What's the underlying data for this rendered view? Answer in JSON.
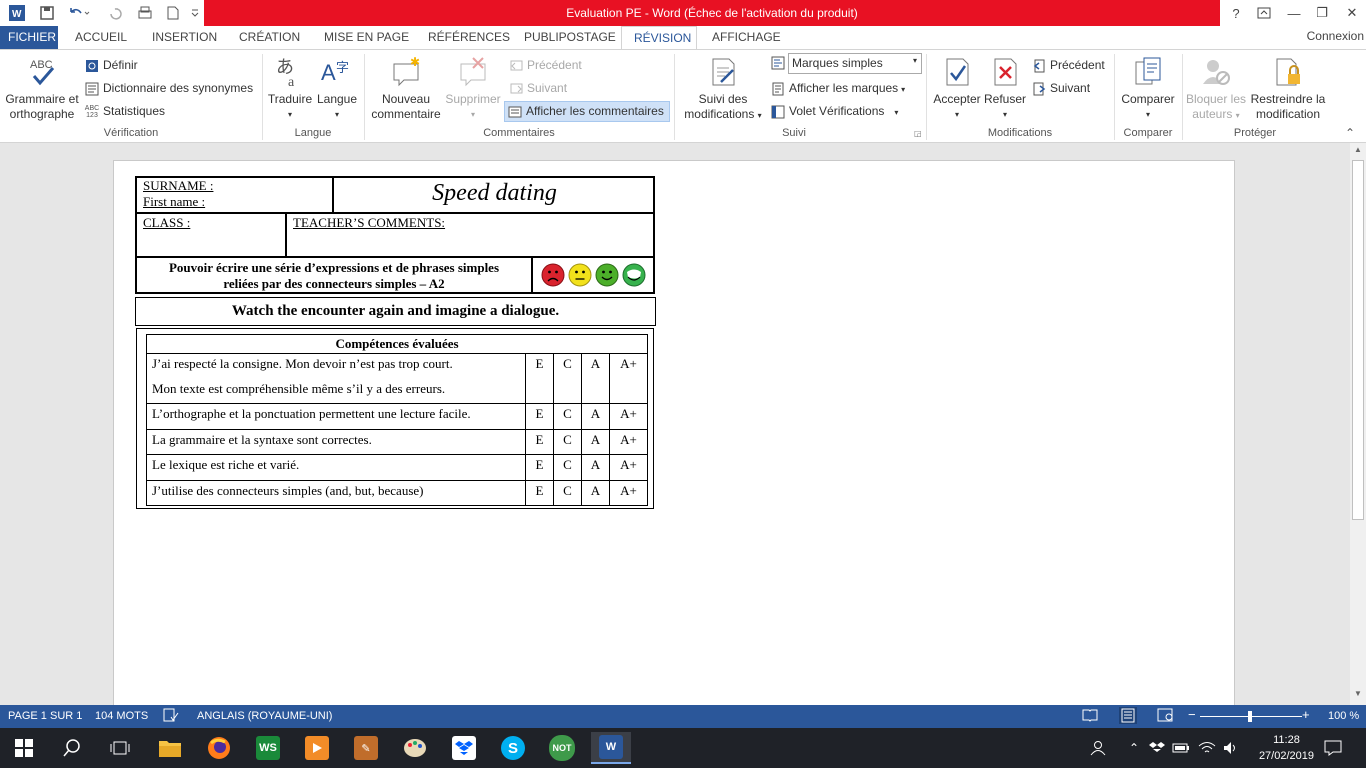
{
  "window": {
    "title": "Evaluation PE -  Word (Échec de l'activation du produit)",
    "help": "?",
    "minimize": "—",
    "restore": "❐",
    "close": "✕"
  },
  "tabs": {
    "file": "FICHIER",
    "items": [
      "ACCUEIL",
      "INSERTION",
      "CRÉATION",
      "MISE EN PAGE",
      "RÉFÉRENCES",
      "PUBLIPOSTAGE",
      "RÉVISION",
      "AFFICHAGE"
    ],
    "active": "RÉVISION",
    "connexion": "Connexion"
  },
  "ribbon": {
    "verification": {
      "label": "Vérification",
      "spelling_line1": "Grammaire et",
      "spelling_line2": "orthographe",
      "define": "Définir",
      "thesaurus": "Dictionnaire des synonymes",
      "stats": "Statistiques"
    },
    "langue": {
      "label": "Langue",
      "translate": "Traduire",
      "language": "Langue"
    },
    "commentaires": {
      "label": "Commentaires",
      "new_line1": "Nouveau",
      "new_line2": "commentaire",
      "delete": "Supprimer",
      "previous": "Précédent",
      "next": "Suivant",
      "show": "Afficher les commentaires"
    },
    "suivi": {
      "label": "Suivi",
      "track_line1": "Suivi des",
      "track_line2": "modifications",
      "markup_select": "Marques simples",
      "show_markup": "Afficher les marques",
      "reviewing_pane": "Volet Vérifications"
    },
    "modifications": {
      "label": "Modifications",
      "accept": "Accepter",
      "reject": "Refuser",
      "previous": "Précédent",
      "next": "Suivant"
    },
    "comparer": {
      "label": "Comparer",
      "compare": "Comparer"
    },
    "proteger": {
      "label": "Protéger",
      "block_line1": "Bloquer les",
      "block_line2": "auteurs",
      "restrict_line1": "Restreindre la",
      "restrict_line2": "modification"
    }
  },
  "document": {
    "surname": "SURNAME :",
    "first_name": "First name :",
    "title": "Speed dating",
    "class": "CLASS :",
    "teacher_comments": "TEACHER’S COMMENTS:",
    "objective_line1": "Pouvoir écrire une série d’expressions et de phrases simples",
    "objective_line2": "reliées par des connecteurs simples – A2",
    "instruction": "Watch the encounter again and imagine a dialogue.",
    "competences_header": "Compétences évaluées",
    "grades": [
      "E",
      "C",
      "A",
      "A+"
    ],
    "rows": [
      {
        "line1": "J’ai respecté la consigne. Mon devoir n’est pas trop court.",
        "line2": "Mon texte est compréhensible même s’il y a des erreurs."
      },
      {
        "line1": "L’orthographe et la ponctuation permettent une lecture facile.",
        "line2": ""
      },
      {
        "line1": "La grammaire et la syntaxe sont correctes.",
        "line2": ""
      },
      {
        "line1": "Le lexique est riche et varié.",
        "line2": ""
      },
      {
        "line1": "J’utilise des connecteurs simples (and, but, because)",
        "line2": ""
      }
    ],
    "smileys": [
      {
        "icon": "sad-face-icon",
        "color": "#d9232d"
      },
      {
        "icon": "neutral-face-icon",
        "color": "#f2e11b"
      },
      {
        "icon": "smile-face-icon",
        "color": "#4caf2a"
      },
      {
        "icon": "grin-face-icon",
        "color": "#37b24d"
      }
    ]
  },
  "status": {
    "page": "PAGE 1 SUR 1",
    "words": "104 MOTS",
    "language": "ANGLAIS (ROYAUME-UNI)",
    "zoom": "100 %"
  },
  "taskbar": {
    "time": "11:28",
    "date": "27/02/2019",
    "notes_label": "NOT"
  }
}
